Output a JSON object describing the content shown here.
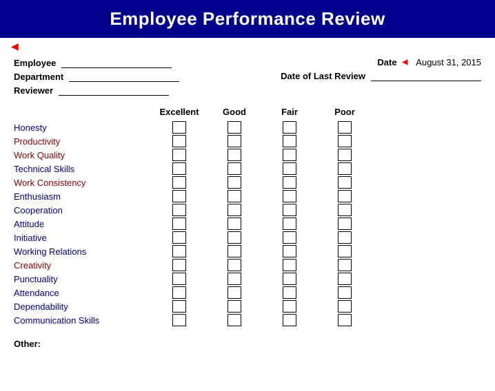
{
  "header": {
    "title": "Employee Performance Review"
  },
  "form": {
    "employee_label": "Employee",
    "department_label": "Department",
    "reviewer_label": "Reviewer",
    "date_label": "Date",
    "date_value": "August 31, 2015",
    "date_of_last_review_label": "Date of Last Review"
  },
  "ratings": {
    "columns": [
      "Excellent",
      "Good",
      "Fair",
      "Poor"
    ],
    "rows": [
      {
        "label": "Honesty",
        "color": "dark-blue"
      },
      {
        "label": "Productivity",
        "color": "dark-red"
      },
      {
        "label": "Work Quality",
        "color": "dark-red"
      },
      {
        "label": "Technical Skills",
        "color": "dark-blue"
      },
      {
        "label": "Work Consistency",
        "color": "dark-red"
      },
      {
        "label": "Enthusiasm",
        "color": "dark-blue"
      },
      {
        "label": "Cooperation",
        "color": "dark-blue"
      },
      {
        "label": "Attitude",
        "color": "dark-blue"
      },
      {
        "label": "Initiative",
        "color": "dark-blue"
      },
      {
        "label": "Working Relations",
        "color": "dark-blue"
      },
      {
        "label": "Creativity",
        "color": "dark-red"
      },
      {
        "label": "Punctuality",
        "color": "dark-blue"
      },
      {
        "label": "Attendance",
        "color": "dark-blue"
      },
      {
        "label": "Dependability",
        "color": "dark-blue"
      },
      {
        "label": "Communication Skills",
        "color": "dark-blue"
      }
    ]
  },
  "other_label": "Other:"
}
